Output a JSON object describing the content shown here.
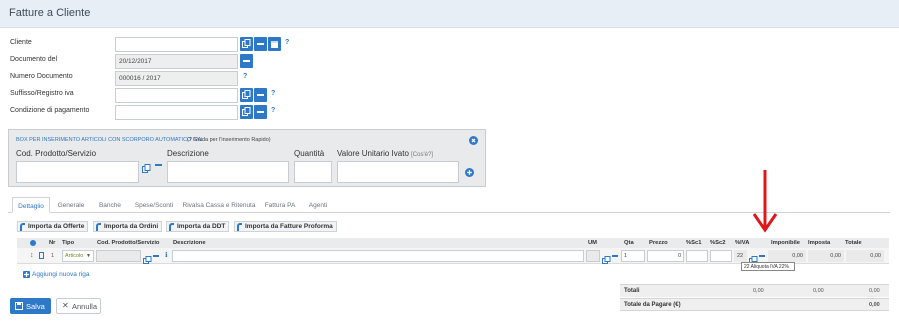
{
  "header": {
    "title": "Fatture a Cliente"
  },
  "form": {
    "cliente_label": "Cliente",
    "documento_label": "Documento del",
    "documento_value": "20/12/2017",
    "numero_label": "Numero Documento",
    "numero_value": "000016 / 2017",
    "suffisso_label": "Suffisso/Registro iva",
    "condizione_label": "Condizione di pagamento",
    "help": "?"
  },
  "box": {
    "title": "BOX PER INSERIMENTO ARTICOLI CON SCORPORO AUTOMATICO IVA.",
    "guide": "(? Guida per l'inserimento Rapido)",
    "cod_label": "Cod. Prodotto/Servizio",
    "desc_label": "Descrizione",
    "qty_label": "Quantità",
    "valore_label": "Valore Unitario Ivato",
    "cose_label": "[Cos'è?]"
  },
  "tabs": [
    "Dettaglio",
    "Generale",
    "Banche",
    "Spese/Sconti",
    "Rivalsa Cassa e Ritenuta",
    "Fattura PA",
    "Agenti"
  ],
  "import_buttons": [
    "Importa da Offerte",
    "Importa da Ordini",
    "Importa da DDT",
    "Importa da Fatture Proforma"
  ],
  "grid": {
    "headers": {
      "nr": "Nr",
      "tipo": "Tipo",
      "cod": "Cod. Prodotto/Servizio",
      "descrizione": "Descrizione",
      "um": "UM",
      "qta": "Qta",
      "prezzo": "Prezzo",
      "sc1": "%Sc1",
      "sc2": "%Sc2",
      "iva": "%IVA",
      "imponibile": "Imponibile",
      "imposta": "Imposta",
      "totale": "Totale"
    },
    "row": {
      "nr": "1",
      "tipo": "Articolo",
      "qta": "1",
      "prezzo": "0",
      "iva": "22",
      "imponibile": "0,00",
      "imposta": "0,00",
      "totale": "0,00"
    },
    "add_row": "Aggiungi nuova riga",
    "tooltip": "22 Aliquota IVA 22%"
  },
  "totals": {
    "totali_label": "Totali",
    "totali_values": [
      "0,00",
      "0,00",
      "0,00"
    ],
    "pagare_label": "Totale da Pagare (€)",
    "pagare_value": "0,00"
  },
  "actions": {
    "save": "Salva",
    "cancel": "Annulla"
  },
  "colors": {
    "accent": "#2e78c8",
    "arrow": "#e0161b",
    "title_bar": "#e8eef6"
  }
}
